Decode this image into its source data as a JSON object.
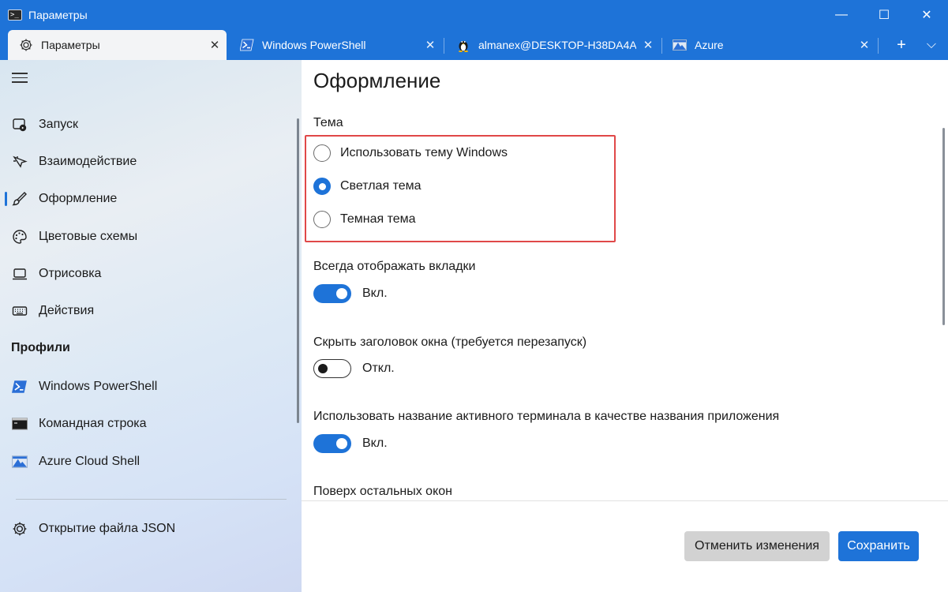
{
  "window": {
    "title": "Параметры",
    "controls": {
      "minimize": "—",
      "maximize": "☐",
      "close": "✕"
    }
  },
  "tabs": [
    {
      "label": "Параметры",
      "icon": "gear-icon",
      "active": true
    },
    {
      "label": "Windows PowerShell",
      "icon": "powershell-icon",
      "active": false
    },
    {
      "label": "almanex@DESKTOP-H38DA4A",
      "icon": "linux-penguin-icon",
      "active": false
    },
    {
      "label": "Azure",
      "icon": "azure-cloud-icon",
      "active": false
    }
  ],
  "tab_controls": {
    "close": "✕",
    "add": "+",
    "dropdown": "⌵"
  },
  "sidebar": {
    "items": [
      {
        "label": "Запуск",
        "icon": "startup-icon"
      },
      {
        "label": "Взаимодействие",
        "icon": "interaction-icon"
      },
      {
        "label": "Оформление",
        "icon": "brush-icon",
        "selected": true
      },
      {
        "label": "Цветовые схемы",
        "icon": "palette-icon"
      },
      {
        "label": "Отрисовка",
        "icon": "laptop-icon"
      },
      {
        "label": "Действия",
        "icon": "keyboard-icon"
      }
    ],
    "profiles_title": "Профили",
    "profiles": [
      {
        "label": "Windows PowerShell",
        "icon": "powershell-icon"
      },
      {
        "label": "Командная строка",
        "icon": "cmd-icon"
      },
      {
        "label": "Azure Cloud Shell",
        "icon": "azure-cloud-icon"
      }
    ],
    "open_json": {
      "label": "Открытие файла JSON",
      "icon": "gear-icon"
    }
  },
  "main": {
    "title": "Оформление",
    "theme_label": "Тема",
    "theme_options": [
      {
        "label": "Использовать тему Windows",
        "checked": false
      },
      {
        "label": "Светлая тема",
        "checked": true
      },
      {
        "label": "Темная тема",
        "checked": false
      }
    ],
    "always_show_tabs": {
      "label": "Всегда отображать вкладки",
      "state": "Вкл.",
      "on": true
    },
    "hide_titlebar": {
      "label": "Скрыть заголовок окна (требуется перезапуск)",
      "state": "Откл.",
      "on": false
    },
    "use_terminal_title": {
      "label": "Использовать название активного терминала в качестве названия приложения",
      "state": "Вкл.",
      "on": true
    },
    "always_on_top": {
      "label": "Поверх остальных окон"
    }
  },
  "footer": {
    "discard_label": "Отменить изменения",
    "save_label": "Сохранить"
  },
  "colors": {
    "accent": "#1e73d8",
    "highlight": "#e04848"
  }
}
